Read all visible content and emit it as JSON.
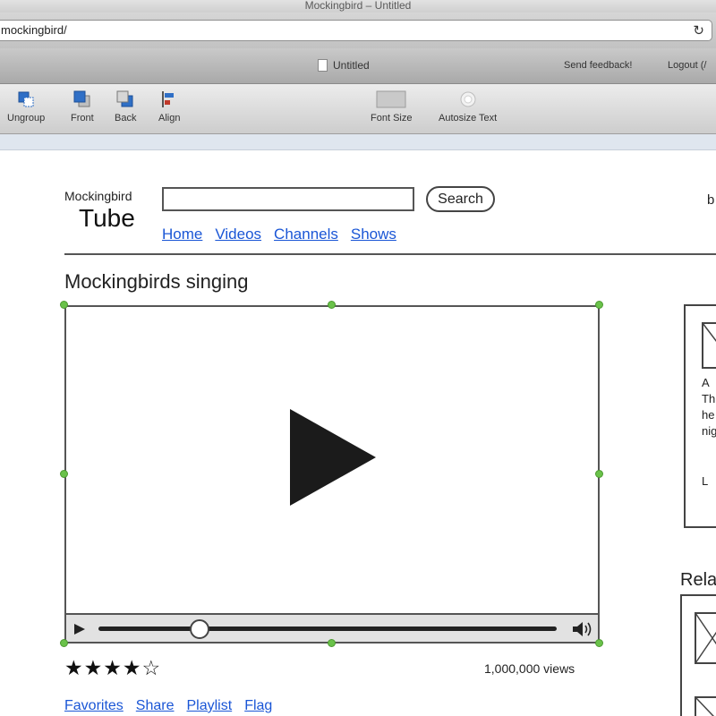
{
  "window": {
    "title": "Mockingbird – Untitled",
    "url": "mockingbird/"
  },
  "tabbar": {
    "document_title": "Untitled",
    "send_feedback": "Send feedback!",
    "logout": "Logout (/"
  },
  "toolbar": {
    "items": [
      {
        "label": "Ungroup",
        "icon": "ungroup-icon"
      },
      {
        "label": "Front",
        "icon": "bring-to-front-icon"
      },
      {
        "label": "Back",
        "icon": "send-to-back-icon"
      },
      {
        "label": "Align",
        "icon": "align-icon"
      },
      {
        "label": "Font Size",
        "icon": "font-size-icon"
      },
      {
        "label": "Autosize Text",
        "icon": "autosize-text-icon"
      }
    ]
  },
  "page": {
    "logo_top": "Mockingbird",
    "logo_bottom": "Tube",
    "search_button": "Search",
    "search_value": "",
    "right_partial": "b",
    "nav": [
      "Home",
      "Videos",
      "Channels",
      "Shows"
    ],
    "video_title": "Mockingbirds singing",
    "rating_text": "★★★★☆",
    "rating_value": 4,
    "rating_max": 5,
    "views": "1,000,000 views",
    "playback_progress": 0.22,
    "actions": [
      "Favorites",
      "Share",
      "Playlist",
      "Flag"
    ]
  },
  "sidebar": {
    "lines": [
      "A",
      "Th",
      "he",
      "nig",
      "L"
    ],
    "related_title": "Rela"
  },
  "colors": {
    "link": "#1a56d6",
    "selection_handle": "#6ac24a",
    "wire_stroke": "#555555"
  }
}
